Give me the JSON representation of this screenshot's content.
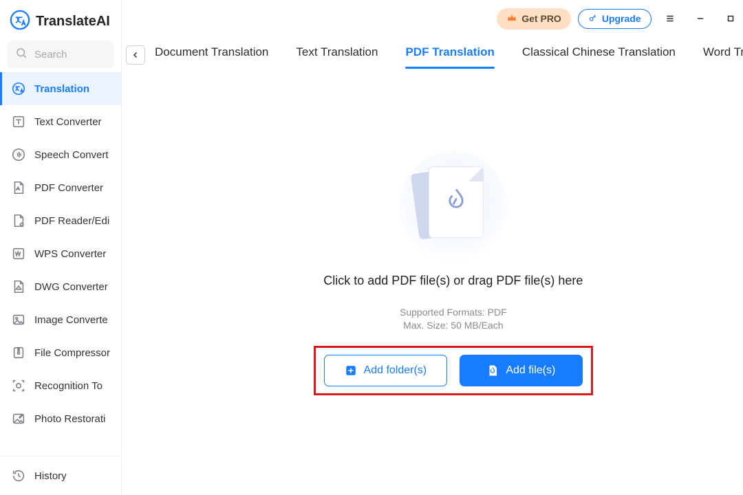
{
  "brand": {
    "name": "TranslateAI"
  },
  "search": {
    "placeholder": "Search"
  },
  "sidebar": {
    "items": [
      {
        "label": "Translation"
      },
      {
        "label": "Text Converter"
      },
      {
        "label": "Speech Convert"
      },
      {
        "label": "PDF Converter"
      },
      {
        "label": "PDF Reader/Edi"
      },
      {
        "label": "WPS Converter"
      },
      {
        "label": "DWG Converter"
      },
      {
        "label": "Image Converte"
      },
      {
        "label": "File Compressor"
      },
      {
        "label": "Recognition To"
      },
      {
        "label": "Photo Restorati"
      }
    ],
    "history": {
      "label": "History"
    }
  },
  "titlebar": {
    "get_pro": "Get PRO",
    "upgrade": "Upgrade"
  },
  "tabs": [
    {
      "label": "Document Translation"
    },
    {
      "label": "Text Translation"
    },
    {
      "label": "PDF Translation"
    },
    {
      "label": "Classical Chinese Translation"
    },
    {
      "label": "Word Translatio"
    }
  ],
  "drop": {
    "title": "Click to add PDF file(s) or drag PDF file(s) here",
    "formats": "Supported Formats: PDF",
    "maxsize": "Max. Size: 50 MB/Each",
    "add_folder": "Add folder(s)",
    "add_file": "Add file(s)"
  }
}
